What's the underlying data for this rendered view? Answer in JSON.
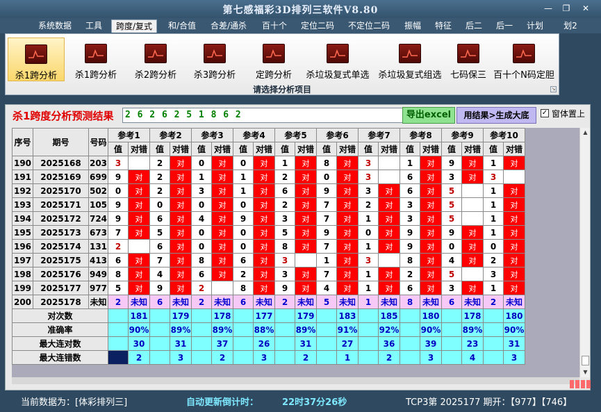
{
  "app": {
    "title": "第七感福彩3D排列三软件V8.80"
  },
  "menu": [
    "系统数据",
    "工具",
    "跨度/复式",
    "和/合值",
    "合差/通杀",
    "百十个",
    "定位二码",
    "不定位二码",
    "振幅",
    "特征",
    "后二",
    "后一",
    "计划",
    "划2"
  ],
  "ribbon": {
    "buttons": [
      "杀1跨分析",
      "杀1跨分析",
      "杀2跨分析",
      "杀3跨分析",
      "定跨分析",
      "杀垃圾复式单选",
      "杀垃圾复式组选",
      "七码保三",
      "百十个N码定胆"
    ],
    "selected": 0,
    "group_label": "请选择分析项目"
  },
  "result": {
    "label": "杀1跨度分析预测结果",
    "value": "2 6 2 6 2 5 1 8 6 2",
    "excel_button": "导出excel",
    "gen_button": "用结果>生成大底",
    "pin_checkbox": "窗体置上"
  },
  "table": {
    "headers": {
      "seq": "序号",
      "period": "期号",
      "number": "号码",
      "value": "值",
      "result": "对错"
    },
    "refs": [
      "参考1",
      "参考2",
      "参考3",
      "参考4",
      "参考5",
      "参考6",
      "参考7",
      "参考8",
      "参考9",
      "参考10"
    ],
    "rows": [
      {
        "seq": "190",
        "period": "2025168",
        "num": "203",
        "cells": [
          [
            "3",
            0,
            1
          ],
          [
            "2",
            1,
            0
          ],
          [
            "0",
            1,
            0
          ],
          [
            "0",
            1,
            0
          ],
          [
            "1",
            1,
            0
          ],
          [
            "8",
            1,
            0
          ],
          [
            "3",
            0,
            1
          ],
          [
            "1",
            1,
            0
          ],
          [
            "9",
            1,
            0
          ],
          [
            "1",
            1,
            0
          ]
        ]
      },
      {
        "seq": "191",
        "period": "2025169",
        "num": "699",
        "cells": [
          [
            "9",
            1,
            0
          ],
          [
            "2",
            1,
            0
          ],
          [
            "1",
            1,
            0
          ],
          [
            "1",
            1,
            0
          ],
          [
            "2",
            1,
            0
          ],
          [
            "0",
            1,
            0
          ],
          [
            "3",
            0,
            1
          ],
          [
            "6",
            1,
            0
          ],
          [
            "3",
            1,
            0
          ],
          [
            "3",
            0,
            1
          ]
        ]
      },
      {
        "seq": "192",
        "period": "2025170",
        "num": "502",
        "cells": [
          [
            "0",
            1,
            0
          ],
          [
            "2",
            1,
            0
          ],
          [
            "3",
            1,
            0
          ],
          [
            "1",
            1,
            0
          ],
          [
            "6",
            1,
            0
          ],
          [
            "9",
            1,
            0
          ],
          [
            "3",
            1,
            0
          ],
          [
            "6",
            1,
            0
          ],
          [
            "5",
            0,
            1
          ],
          [
            "1",
            1,
            0
          ]
        ]
      },
      {
        "seq": "193",
        "period": "2025171",
        "num": "105",
        "cells": [
          [
            "9",
            1,
            0
          ],
          [
            "0",
            1,
            0
          ],
          [
            "0",
            1,
            0
          ],
          [
            "0",
            1,
            0
          ],
          [
            "2",
            1,
            0
          ],
          [
            "7",
            1,
            0
          ],
          [
            "2",
            1,
            0
          ],
          [
            "3",
            1,
            0
          ],
          [
            "5",
            0,
            1
          ],
          [
            "1",
            1,
            0
          ]
        ]
      },
      {
        "seq": "194",
        "period": "2025172",
        "num": "724",
        "cells": [
          [
            "9",
            1,
            0
          ],
          [
            "6",
            1,
            0
          ],
          [
            "4",
            1,
            0
          ],
          [
            "9",
            1,
            0
          ],
          [
            "3",
            1,
            0
          ],
          [
            "7",
            1,
            0
          ],
          [
            "1",
            1,
            0
          ],
          [
            "3",
            1,
            0
          ],
          [
            "5",
            0,
            1
          ],
          [
            "1",
            1,
            0
          ]
        ]
      },
      {
        "seq": "195",
        "period": "2025173",
        "num": "673",
        "cells": [
          [
            "7",
            1,
            0
          ],
          [
            "5",
            1,
            0
          ],
          [
            "0",
            1,
            0
          ],
          [
            "0",
            1,
            0
          ],
          [
            "5",
            1,
            0
          ],
          [
            "9",
            1,
            0
          ],
          [
            "0",
            1,
            0
          ],
          [
            "9",
            1,
            0
          ],
          [
            "9",
            1,
            0
          ],
          [
            "1",
            1,
            0
          ]
        ]
      },
      {
        "seq": "196",
        "period": "2025174",
        "num": "131",
        "cells": [
          [
            "2",
            0,
            1
          ],
          [
            "6",
            1,
            0
          ],
          [
            "0",
            1,
            0
          ],
          [
            "0",
            1,
            0
          ],
          [
            "8",
            1,
            0
          ],
          [
            "7",
            1,
            0
          ],
          [
            "1",
            1,
            0
          ],
          [
            "9",
            1,
            0
          ],
          [
            "0",
            1,
            0
          ],
          [
            "0",
            1,
            0
          ]
        ]
      },
      {
        "seq": "197",
        "period": "2025175",
        "num": "413",
        "cells": [
          [
            "6",
            1,
            0
          ],
          [
            "7",
            1,
            0
          ],
          [
            "8",
            1,
            0
          ],
          [
            "6",
            1,
            0
          ],
          [
            "3",
            0,
            1
          ],
          [
            "1",
            1,
            0
          ],
          [
            "3",
            0,
            1
          ],
          [
            "8",
            1,
            0
          ],
          [
            "4",
            1,
            0
          ],
          [
            "2",
            1,
            0
          ]
        ]
      },
      {
        "seq": "198",
        "period": "2025176",
        "num": "949",
        "cells": [
          [
            "8",
            1,
            0
          ],
          [
            "4",
            1,
            0
          ],
          [
            "6",
            1,
            0
          ],
          [
            "2",
            1,
            0
          ],
          [
            "3",
            1,
            0
          ],
          [
            "7",
            1,
            0
          ],
          [
            "1",
            1,
            0
          ],
          [
            "2",
            1,
            0
          ],
          [
            "5",
            0,
            1
          ],
          [
            "3",
            1,
            0
          ]
        ]
      },
      {
        "seq": "199",
        "period": "2025177",
        "num": "977",
        "cells": [
          [
            "5",
            1,
            0
          ],
          [
            "9",
            1,
            0
          ],
          [
            "2",
            0,
            1
          ],
          [
            "8",
            1,
            0
          ],
          [
            "9",
            1,
            0
          ],
          [
            "4",
            1,
            0
          ],
          [
            "1",
            1,
            0
          ],
          [
            "6",
            1,
            0
          ],
          [
            "3",
            1,
            0
          ],
          [
            "1",
            1,
            0
          ]
        ]
      }
    ],
    "last_row": {
      "seq": "200",
      "period": "2025178",
      "num": "未知",
      "values": [
        "2",
        "6",
        "2",
        "6",
        "2",
        "5",
        "1",
        "8",
        "6",
        "2"
      ],
      "unknown": "未知"
    },
    "mark": "对",
    "stats": [
      {
        "label": "对次数",
        "values": [
          "181",
          "179",
          "178",
          "177",
          "179",
          "183",
          "185",
          "180",
          "178",
          "180"
        ]
      },
      {
        "label": "准确率",
        "values": [
          "90%",
          "89%",
          "89%",
          "88%",
          "89%",
          "91%",
          "92%",
          "90%",
          "89%",
          "90%"
        ]
      },
      {
        "label": "最大连对数",
        "values": [
          "30",
          "31",
          "37",
          "26",
          "31",
          "27",
          "36",
          "39",
          "23",
          "31"
        ]
      },
      {
        "label": "最大连错数",
        "values": [
          "2",
          "3",
          "2",
          "3",
          "2",
          "1",
          "2",
          "3",
          "4",
          "3"
        ]
      }
    ]
  },
  "status": {
    "current_label": "当前数据为：[体彩排列三]",
    "countdown_label": "自动更新倒计时：",
    "countdown": "22时37分26秒",
    "draw_info": "TCP3第 2025177 期开：【977】【746】"
  }
}
